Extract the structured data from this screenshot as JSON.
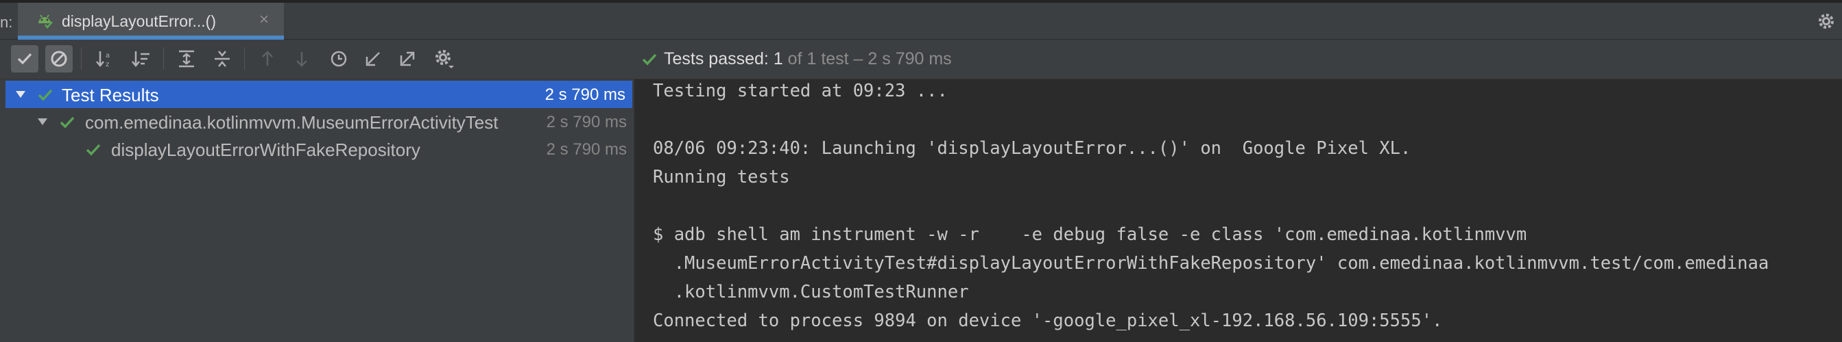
{
  "window": {
    "run_prefix": "n:",
    "tab_title": "displayLayoutError...()",
    "tab_close": "×"
  },
  "toolbar": {
    "icons": [
      "show-passed-icon",
      "show-ignored-icon",
      "sort-alphabetically-icon",
      "sort-by-duration-icon",
      "expand-all-icon",
      "collapse-all-icon",
      "previous-failed-icon",
      "next-failed-icon",
      "test-history-icon",
      "import-tests-icon",
      "export-tests-icon",
      "settings-icon"
    ]
  },
  "status": {
    "label": "Tests passed:",
    "count": "1",
    "detail": "of 1 test – 2 s 790 ms"
  },
  "tree": {
    "rows": [
      {
        "label": "Test Results",
        "time": "2 s 790 ms"
      },
      {
        "label": "com.emedinaa.kotlinmvvm.MuseumErrorActivityTest",
        "time": "2 s 790 ms"
      },
      {
        "label": "displayLayoutErrorWithFakeRepository",
        "time": "2 s 790 ms"
      }
    ]
  },
  "console": {
    "lines": [
      "Testing started at 09:23 ...",
      "",
      "08/06 09:23:40: Launching 'displayLayoutError...()' on  Google Pixel XL.",
      "Running tests",
      "",
      "$ adb shell am instrument -w -r    -e debug false -e class 'com.emedinaa.kotlinmvvm",
      "  .MuseumErrorActivityTest#displayLayoutErrorWithFakeRepository' com.emedinaa.kotlinmvvm.test/com.emedinaa",
      "  .kotlinmvvm.CustomTestRunner",
      "Connected to process 9894 on device '-google_pixel_xl-192.168.56.109:5555'."
    ]
  },
  "colors": {
    "pass_green": "#5aa356",
    "selection": "#2f65ca",
    "tab_underline": "#4a88c7"
  }
}
